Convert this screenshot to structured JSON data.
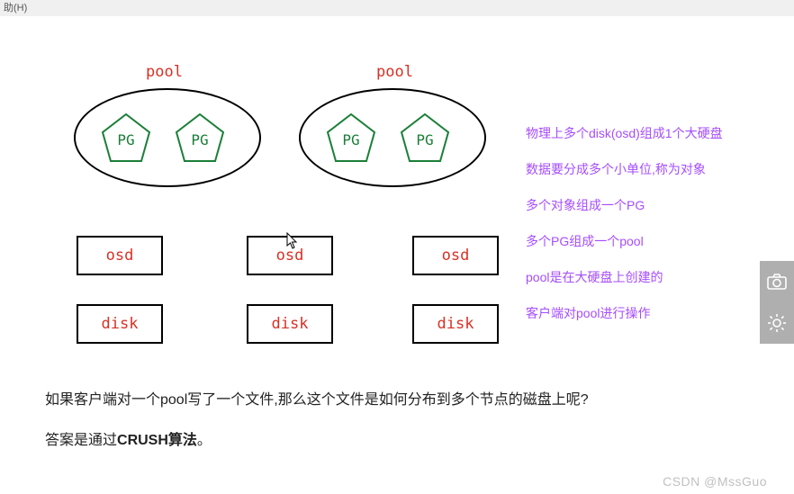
{
  "topbar": {
    "help": "助(H)"
  },
  "pools": [
    {
      "label": "pool"
    },
    {
      "label": "pool"
    }
  ],
  "pg_label": "PG",
  "osd_label": "osd",
  "disk_label": "disk",
  "boxes": {
    "osd": [
      "osd",
      "osd",
      "osd"
    ],
    "disk": [
      "disk",
      "disk",
      "disk"
    ]
  },
  "notes": [
    "物理上多个disk(osd)组成1个大硬盘",
    "数据要分成多个小单位,称为对象",
    "多个对象组成一个PG",
    "多个PG组成一个pool",
    "pool是在大硬盘上创建的",
    "客户端对pool进行操作"
  ],
  "question": "如果客户端对一个pool写了一个文件,那么这个文件是如何分布到多个节点的磁盘上呢?",
  "answer_prefix": "答案是通过",
  "answer_bold": "CRUSH算法",
  "answer_suffix": "。",
  "watermark": "CSDN @MssGuo"
}
